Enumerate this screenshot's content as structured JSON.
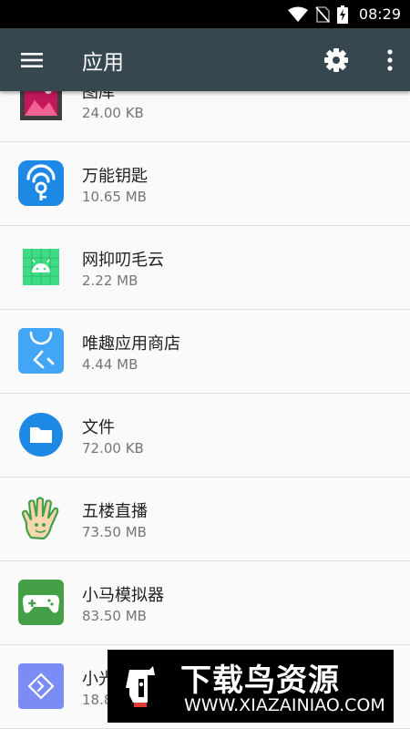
{
  "status_bar": {
    "time": "08:29",
    "icons": [
      "wifi-icon",
      "no-sim-icon",
      "battery-charging-icon"
    ]
  },
  "app_bar": {
    "title": "应用",
    "icons": [
      "menu-icon",
      "gear-icon",
      "more-vert-icon"
    ]
  },
  "apps": [
    {
      "name": "图库",
      "size": "24.00 KB",
      "icon": "gallery-icon"
    },
    {
      "name": "万能钥匙",
      "size": "10.65 MB",
      "icon": "wifi-key-icon"
    },
    {
      "name": "网抑叨毛云",
      "size": "2.22 MB",
      "icon": "android-icon"
    },
    {
      "name": "唯趣应用商店",
      "size": "4.44 MB",
      "icon": "store-bag-icon"
    },
    {
      "name": "文件",
      "size": "72.00 KB",
      "icon": "folder-icon"
    },
    {
      "name": "五楼直播",
      "size": "73.50 MB",
      "icon": "hand-icon"
    },
    {
      "name": "小马模拟器",
      "size": "83.50 MB",
      "icon": "gamepad-icon"
    },
    {
      "name": "小光",
      "size": "18.8",
      "icon": "diamond-icon"
    }
  ],
  "watermark": {
    "title": "下载鸟资源",
    "url": "WWW.XIAZAINIAO.COM"
  },
  "colors": {
    "app_bar": "#37474f",
    "status_bar": "#000000",
    "background": "#fafafa",
    "primary_text": "#212121",
    "secondary_text": "#757575"
  }
}
